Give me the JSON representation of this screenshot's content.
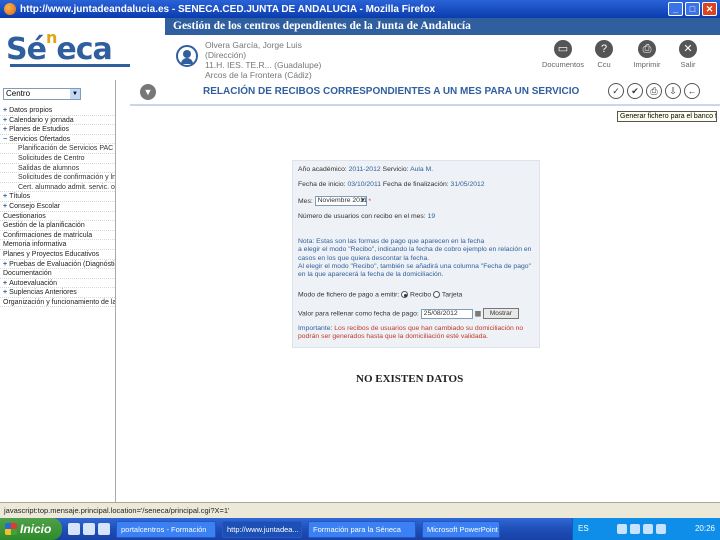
{
  "window": {
    "title": "http://www.juntadeandalucia.es - SENECA.CED.JUNTA DE ANDALUCIA - Mozilla Firefox",
    "buttons": {
      "minimize": "_",
      "maximize": "□",
      "close": "✕"
    }
  },
  "header": {
    "band_title": "Gestión de los centros dependientes de la Junta de Andalucía",
    "logo": {
      "s": "Sé",
      "n": "n",
      "eca": "eca"
    },
    "user_lines": [
      "Olvera García, Jorge Luis",
      "(Dirección)",
      "11.H. IES. TE.R... (Guadalupe)",
      "Arcos de la Frontera (Cádiz)"
    ],
    "tools": [
      {
        "icon": "documents-icon",
        "glyph": "▭",
        "label": "Documentos"
      },
      {
        "icon": "help-icon",
        "glyph": "?",
        "label": "Ccu"
      },
      {
        "icon": "printer-icon",
        "glyph": "⎙",
        "label": "Imprimir"
      },
      {
        "icon": "exit-icon",
        "glyph": "✕",
        "label": "Salir"
      }
    ]
  },
  "sidebar": {
    "selector_value": "Centro",
    "items": [
      {
        "pm": "+",
        "label": "Datos propios",
        "sub": false
      },
      {
        "pm": "+",
        "label": "Calendario y jornada",
        "sub": false
      },
      {
        "pm": "+",
        "label": "Planes de Estudios",
        "sub": false
      },
      {
        "pm": "−",
        "label": "Servicios Ofertados",
        "sub": false
      },
      {
        "pm": "",
        "label": "Planificación de Servicios PAC",
        "sub": true
      },
      {
        "pm": "",
        "label": "Solicitudes de Centro",
        "sub": true
      },
      {
        "pm": "",
        "label": "Salidas de alumnos",
        "sub": true
      },
      {
        "pm": "",
        "label": "Solicitudes de confirmación y lne",
        "sub": true
      },
      {
        "pm": "",
        "label": "Cert. alumnado admit. servic. ofert",
        "sub": true
      },
      {
        "pm": "+",
        "label": "Títulos",
        "sub": false
      },
      {
        "pm": "+",
        "label": "Consejo Escolar",
        "sub": false
      },
      {
        "pm": "",
        "label": "Cuestionarios",
        "sub": false
      },
      {
        "pm": "",
        "label": "Gestión de la planificación",
        "sub": false
      },
      {
        "pm": "",
        "label": "Confirmaciones de matrícula",
        "sub": false
      },
      {
        "pm": "",
        "label": "Memoria informativa",
        "sub": false
      },
      {
        "pm": "",
        "label": "Planes y Proyectos Educativos",
        "sub": false
      },
      {
        "pm": "+",
        "label": "Pruebas de Evaluación (Diagnóstico)",
        "sub": false
      },
      {
        "pm": "",
        "label": "Documentación",
        "sub": false
      },
      {
        "pm": "+",
        "label": "Autoevaluación",
        "sub": false
      },
      {
        "pm": "+",
        "label": "Suplencias Anteriores",
        "sub": false
      },
      {
        "pm": "",
        "label": "Organización y funcionamiento de la",
        "sub": false
      }
    ]
  },
  "content": {
    "title": "RELACIÓN DE RECIBOS CORRESPONDIENTES A UN MES PARA UN SERVICIO",
    "tooltip": "Generar fichero para el banco fichero",
    "action_icons": [
      {
        "name": "accept-icon",
        "glyph": "✓"
      },
      {
        "name": "validate-icon",
        "glyph": "✔"
      },
      {
        "name": "print-icon",
        "glyph": "⎙"
      },
      {
        "name": "export-icon",
        "glyph": "⇩"
      },
      {
        "name": "back-arrow-icon",
        "glyph": "←"
      }
    ],
    "form": {
      "year_label": "Año académico:",
      "year_value": "2011-2012",
      "service_label": "Servicio:",
      "service_value": "Aula M.",
      "start_label": "Fecha de inicio:",
      "start_value": "03/10/2011",
      "end_label": "Fecha de finalización:",
      "end_value": "31/05/2012",
      "month_label": "Mes:",
      "month_value": "Noviembre 2011",
      "month_required": "*",
      "count_label": "Número de usuarios con recibo en el mes:",
      "count_value": "19",
      "note_lines": [
        "Nota: Estas son las formas de pago que aparecen en la fecha",
        "a elegir el modo \"Recibo\", indicando la fecha de cobro ejemplo en relación en",
        "casos en los que quiera descontar la fecha.",
        "Al elegir el modo \"Recibo\", también se añadirá una columna \"Fecha de pago\"",
        "en la que aparecerá la fecha de la domiciliación."
      ],
      "payment_label": "Modo de fichero de pago a emitir:",
      "payment_options": [
        {
          "label": "Recibo",
          "selected": true
        },
        {
          "label": "Tarjeta",
          "selected": false
        }
      ],
      "date_label": "Valor para rellenar como fecha de pago:",
      "date_value": "25/08/2012",
      "date_button": "Mostrar",
      "important_label": "Importante:",
      "important_text": "Los recibos de usuarios que han cambiado su domiciliación no podrán ser generados hasta que la domiciliación esté validada."
    },
    "no_data": "NO EXISTEN DATOS"
  },
  "statusbar": {
    "text": "javascript:top.mensaje.principal.location='/seneca/principal.cgi?X=1'"
  },
  "taskbar": {
    "start": "Inicio",
    "tasks": [
      {
        "label": "portalcentros - Formación",
        "active": false
      },
      {
        "label": "http://www.juntadea...",
        "active": true
      },
      {
        "label": "Formación para la Séneca",
        "active": false
      },
      {
        "label": "Microsoft PowerPoint -",
        "active": false
      }
    ],
    "tray_lang": "ES",
    "clock": "20:26"
  },
  "colors": {
    "brand": "#2f5f9e",
    "accent_gold": "#e0a419",
    "important": "#c0392b"
  }
}
